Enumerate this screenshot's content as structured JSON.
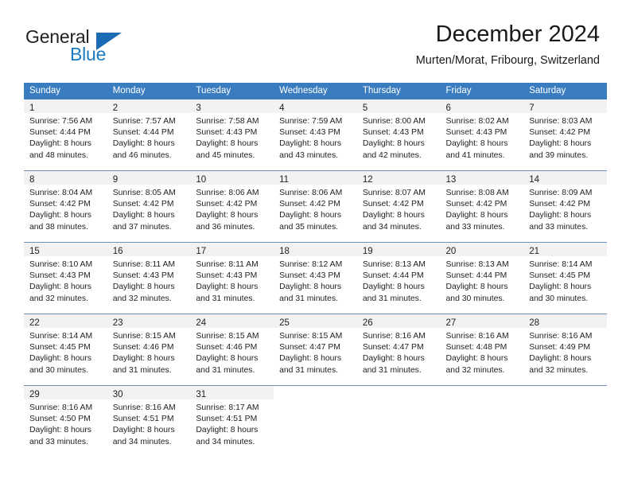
{
  "brand": {
    "name_top": "General",
    "name_bottom": "Blue",
    "triangle_icon": "triangle-icon",
    "color_dark": "#231f20",
    "color_blue": "#1c7ac0"
  },
  "header": {
    "title": "December 2024",
    "subtitle": "Murten/Morat, Fribourg, Switzerland"
  },
  "theme": {
    "header_bar": "#3a7cc0",
    "daynum_band": "#f2f2f2",
    "row_divider": "#6d92b8",
    "text": "#1f1f1f"
  },
  "weekdays": [
    "Sunday",
    "Monday",
    "Tuesday",
    "Wednesday",
    "Thursday",
    "Friday",
    "Saturday"
  ],
  "weeks": [
    [
      {
        "day": "1",
        "sunrise": "Sunrise: 7:56 AM",
        "sunset": "Sunset: 4:44 PM",
        "daylight1": "Daylight: 8 hours",
        "daylight2": "and 48 minutes."
      },
      {
        "day": "2",
        "sunrise": "Sunrise: 7:57 AM",
        "sunset": "Sunset: 4:44 PM",
        "daylight1": "Daylight: 8 hours",
        "daylight2": "and 46 minutes."
      },
      {
        "day": "3",
        "sunrise": "Sunrise: 7:58 AM",
        "sunset": "Sunset: 4:43 PM",
        "daylight1": "Daylight: 8 hours",
        "daylight2": "and 45 minutes."
      },
      {
        "day": "4",
        "sunrise": "Sunrise: 7:59 AM",
        "sunset": "Sunset: 4:43 PM",
        "daylight1": "Daylight: 8 hours",
        "daylight2": "and 43 minutes."
      },
      {
        "day": "5",
        "sunrise": "Sunrise: 8:00 AM",
        "sunset": "Sunset: 4:43 PM",
        "daylight1": "Daylight: 8 hours",
        "daylight2": "and 42 minutes."
      },
      {
        "day": "6",
        "sunrise": "Sunrise: 8:02 AM",
        "sunset": "Sunset: 4:43 PM",
        "daylight1": "Daylight: 8 hours",
        "daylight2": "and 41 minutes."
      },
      {
        "day": "7",
        "sunrise": "Sunrise: 8:03 AM",
        "sunset": "Sunset: 4:42 PM",
        "daylight1": "Daylight: 8 hours",
        "daylight2": "and 39 minutes."
      }
    ],
    [
      {
        "day": "8",
        "sunrise": "Sunrise: 8:04 AM",
        "sunset": "Sunset: 4:42 PM",
        "daylight1": "Daylight: 8 hours",
        "daylight2": "and 38 minutes."
      },
      {
        "day": "9",
        "sunrise": "Sunrise: 8:05 AM",
        "sunset": "Sunset: 4:42 PM",
        "daylight1": "Daylight: 8 hours",
        "daylight2": "and 37 minutes."
      },
      {
        "day": "10",
        "sunrise": "Sunrise: 8:06 AM",
        "sunset": "Sunset: 4:42 PM",
        "daylight1": "Daylight: 8 hours",
        "daylight2": "and 36 minutes."
      },
      {
        "day": "11",
        "sunrise": "Sunrise: 8:06 AM",
        "sunset": "Sunset: 4:42 PM",
        "daylight1": "Daylight: 8 hours",
        "daylight2": "and 35 minutes."
      },
      {
        "day": "12",
        "sunrise": "Sunrise: 8:07 AM",
        "sunset": "Sunset: 4:42 PM",
        "daylight1": "Daylight: 8 hours",
        "daylight2": "and 34 minutes."
      },
      {
        "day": "13",
        "sunrise": "Sunrise: 8:08 AM",
        "sunset": "Sunset: 4:42 PM",
        "daylight1": "Daylight: 8 hours",
        "daylight2": "and 33 minutes."
      },
      {
        "day": "14",
        "sunrise": "Sunrise: 8:09 AM",
        "sunset": "Sunset: 4:42 PM",
        "daylight1": "Daylight: 8 hours",
        "daylight2": "and 33 minutes."
      }
    ],
    [
      {
        "day": "15",
        "sunrise": "Sunrise: 8:10 AM",
        "sunset": "Sunset: 4:43 PM",
        "daylight1": "Daylight: 8 hours",
        "daylight2": "and 32 minutes."
      },
      {
        "day": "16",
        "sunrise": "Sunrise: 8:11 AM",
        "sunset": "Sunset: 4:43 PM",
        "daylight1": "Daylight: 8 hours",
        "daylight2": "and 32 minutes."
      },
      {
        "day": "17",
        "sunrise": "Sunrise: 8:11 AM",
        "sunset": "Sunset: 4:43 PM",
        "daylight1": "Daylight: 8 hours",
        "daylight2": "and 31 minutes."
      },
      {
        "day": "18",
        "sunrise": "Sunrise: 8:12 AM",
        "sunset": "Sunset: 4:43 PM",
        "daylight1": "Daylight: 8 hours",
        "daylight2": "and 31 minutes."
      },
      {
        "day": "19",
        "sunrise": "Sunrise: 8:13 AM",
        "sunset": "Sunset: 4:44 PM",
        "daylight1": "Daylight: 8 hours",
        "daylight2": "and 31 minutes."
      },
      {
        "day": "20",
        "sunrise": "Sunrise: 8:13 AM",
        "sunset": "Sunset: 4:44 PM",
        "daylight1": "Daylight: 8 hours",
        "daylight2": "and 30 minutes."
      },
      {
        "day": "21",
        "sunrise": "Sunrise: 8:14 AM",
        "sunset": "Sunset: 4:45 PM",
        "daylight1": "Daylight: 8 hours",
        "daylight2": "and 30 minutes."
      }
    ],
    [
      {
        "day": "22",
        "sunrise": "Sunrise: 8:14 AM",
        "sunset": "Sunset: 4:45 PM",
        "daylight1": "Daylight: 8 hours",
        "daylight2": "and 30 minutes."
      },
      {
        "day": "23",
        "sunrise": "Sunrise: 8:15 AM",
        "sunset": "Sunset: 4:46 PM",
        "daylight1": "Daylight: 8 hours",
        "daylight2": "and 31 minutes."
      },
      {
        "day": "24",
        "sunrise": "Sunrise: 8:15 AM",
        "sunset": "Sunset: 4:46 PM",
        "daylight1": "Daylight: 8 hours",
        "daylight2": "and 31 minutes."
      },
      {
        "day": "25",
        "sunrise": "Sunrise: 8:15 AM",
        "sunset": "Sunset: 4:47 PM",
        "daylight1": "Daylight: 8 hours",
        "daylight2": "and 31 minutes."
      },
      {
        "day": "26",
        "sunrise": "Sunrise: 8:16 AM",
        "sunset": "Sunset: 4:47 PM",
        "daylight1": "Daylight: 8 hours",
        "daylight2": "and 31 minutes."
      },
      {
        "day": "27",
        "sunrise": "Sunrise: 8:16 AM",
        "sunset": "Sunset: 4:48 PM",
        "daylight1": "Daylight: 8 hours",
        "daylight2": "and 32 minutes."
      },
      {
        "day": "28",
        "sunrise": "Sunrise: 8:16 AM",
        "sunset": "Sunset: 4:49 PM",
        "daylight1": "Daylight: 8 hours",
        "daylight2": "and 32 minutes."
      }
    ],
    [
      {
        "day": "29",
        "sunrise": "Sunrise: 8:16 AM",
        "sunset": "Sunset: 4:50 PM",
        "daylight1": "Daylight: 8 hours",
        "daylight2": "and 33 minutes."
      },
      {
        "day": "30",
        "sunrise": "Sunrise: 8:16 AM",
        "sunset": "Sunset: 4:51 PM",
        "daylight1": "Daylight: 8 hours",
        "daylight2": "and 34 minutes."
      },
      {
        "day": "31",
        "sunrise": "Sunrise: 8:17 AM",
        "sunset": "Sunset: 4:51 PM",
        "daylight1": "Daylight: 8 hours",
        "daylight2": "and 34 minutes."
      },
      {
        "day": "",
        "sunrise": "",
        "sunset": "",
        "daylight1": "",
        "daylight2": ""
      },
      {
        "day": "",
        "sunrise": "",
        "sunset": "",
        "daylight1": "",
        "daylight2": ""
      },
      {
        "day": "",
        "sunrise": "",
        "sunset": "",
        "daylight1": "",
        "daylight2": ""
      },
      {
        "day": "",
        "sunrise": "",
        "sunset": "",
        "daylight1": "",
        "daylight2": ""
      }
    ]
  ]
}
